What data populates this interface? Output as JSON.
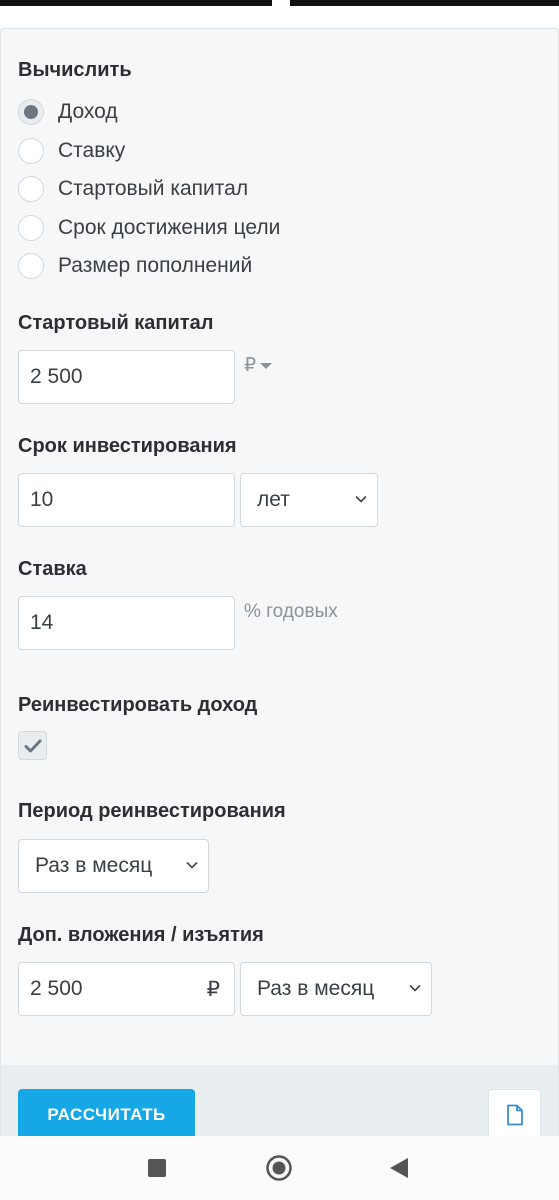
{
  "calculate": {
    "title": "Вычислить",
    "options": [
      {
        "label": "Доход",
        "checked": true
      },
      {
        "label": "Ставку",
        "checked": false
      },
      {
        "label": "Стартовый капитал",
        "checked": false
      },
      {
        "label": "Срок достижения цели",
        "checked": false
      },
      {
        "label": "Размер пополнений",
        "checked": false
      }
    ]
  },
  "start_capital": {
    "title": "Стартовый капитал",
    "value": "2 500",
    "currency": "₽"
  },
  "term": {
    "title": "Срок инвестирования",
    "value": "10",
    "unit": "лет"
  },
  "rate": {
    "title": "Ставка",
    "value": "14",
    "suffix": "% годовых"
  },
  "reinvest": {
    "title": "Реинвестировать доход",
    "checked": true
  },
  "reinvest_period": {
    "title": "Период реинвестирования",
    "value": "Раз в месяц"
  },
  "contributions": {
    "title": "Доп. вложения / изъятия",
    "value": "2 500",
    "currency": "₽",
    "frequency": "Раз в месяц"
  },
  "actions": {
    "calculate_label": "РАССЧИТАТЬ"
  },
  "icons": {
    "document": "document-icon",
    "nav_recents": "square-icon",
    "nav_home": "circle-icon",
    "nav_back": "back-triangle-icon"
  },
  "colors": {
    "accent": "#16a7e6",
    "panel_bg": "#f5f7f9",
    "radio_dot": "#6c7781"
  }
}
